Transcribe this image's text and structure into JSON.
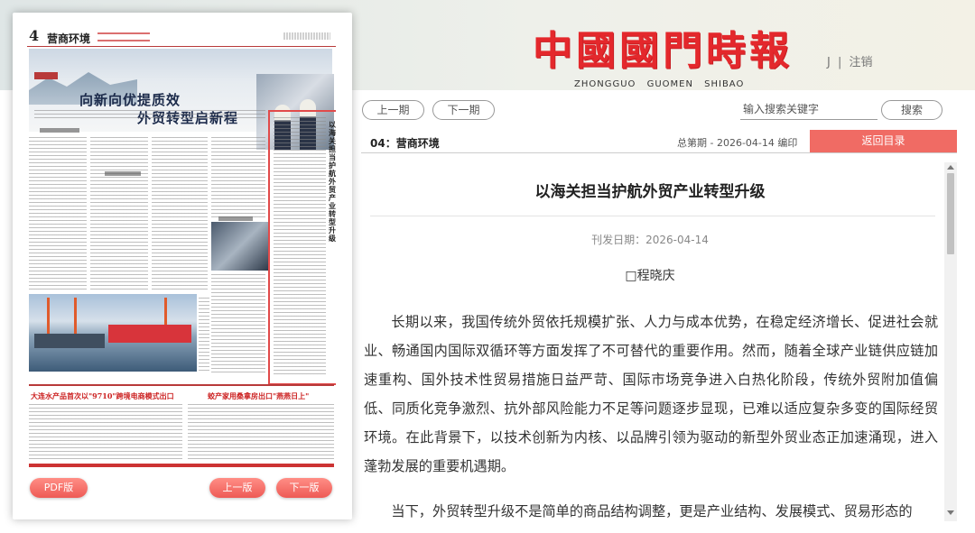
{
  "masthead": {
    "logo_text": "中國國門時報",
    "pinyin": "ZHONGGUO GUOMEN SHIBAO",
    "user_initial": "J",
    "separator": "|",
    "logout": "注销",
    "brand_color": "#e4282c"
  },
  "paper_page": {
    "page_number": "4",
    "section_name": "营商环境",
    "hero_title_line1": "向新向优提质效",
    "hero_title_line2": "外贸转型启新程",
    "boxed_article_title": "以海关担当护航外贸产业转型升级",
    "bottom_headline_left": "大连水产品首次以\"9710\"跨境电商模式出口",
    "bottom_headline_right": "蛟产家用桑拿房出口\"燕燕日上\"",
    "highlight_color": "#e14a4a"
  },
  "paper_controls": {
    "pdf_label": "PDF版",
    "prev_page_label": "上一版",
    "next_page_label": "下一版"
  },
  "toolbar": {
    "prev_issue_label": "上一期",
    "next_issue_label": "下一期",
    "search_placeholder": "输入搜索关键字",
    "search_button_label": "搜索"
  },
  "info_bar": {
    "section_label": "04：营商环境",
    "issue_meta": "总第期 - 2026-04-14 编印",
    "back_button_label": "返回目录",
    "back_button_color": "#f06b64"
  },
  "article": {
    "title": "以海关担当护航外贸产业转型升级",
    "publish_date": "刊发日期：2026-04-14",
    "author": "□程晓庆",
    "paragraphs": [
      "长期以来，我国传统外贸依托规模扩张、人力与成本优势，在稳定经济增长、促进社会就业、畅通国内国际双循环等方面发挥了不可替代的重要作用。然而，随着全球产业链供应链加速重构、国外技术性贸易措施日益严苛、国际市场竞争进入白热化阶段，传统外贸附加值偏低、同质化竞争激烈、抗外部风险能力不足等问题逐步显现，已难以适应复杂多变的国际经贸环境。在此背景下，以技术创新为内核、以品牌引领为驱动的新型外贸业态正加速涌现，进入蓬勃发展的重要机遇期。",
      "当下，外贸转型升级不是简单的商品结构调整，更是产业结构、发展模式、贸易形态的"
    ]
  }
}
